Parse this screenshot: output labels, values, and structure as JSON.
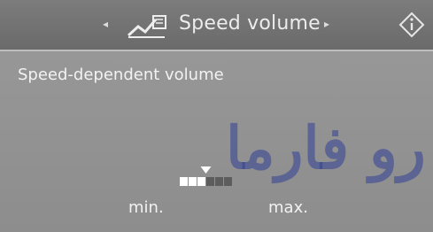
{
  "header": {
    "title": "Speed volume",
    "icon": "speed-volume-icon",
    "left_arrow": "◂",
    "right_arrow": "▸",
    "info_icon": "info-icon"
  },
  "setting": {
    "label": "Speed-dependent volume",
    "min_label": "min.",
    "max_label": "max.",
    "steps_total": 6,
    "steps_active": 3
  },
  "watermark": {
    "text": "رو فارما"
  },
  "colors": {
    "header_bg": "#6f6f6f",
    "panel_bg": "#929292",
    "text": "#f2f2f2",
    "active_step": "#ffffff",
    "inactive_step": "#5d5d5d",
    "watermark": "#304096"
  }
}
